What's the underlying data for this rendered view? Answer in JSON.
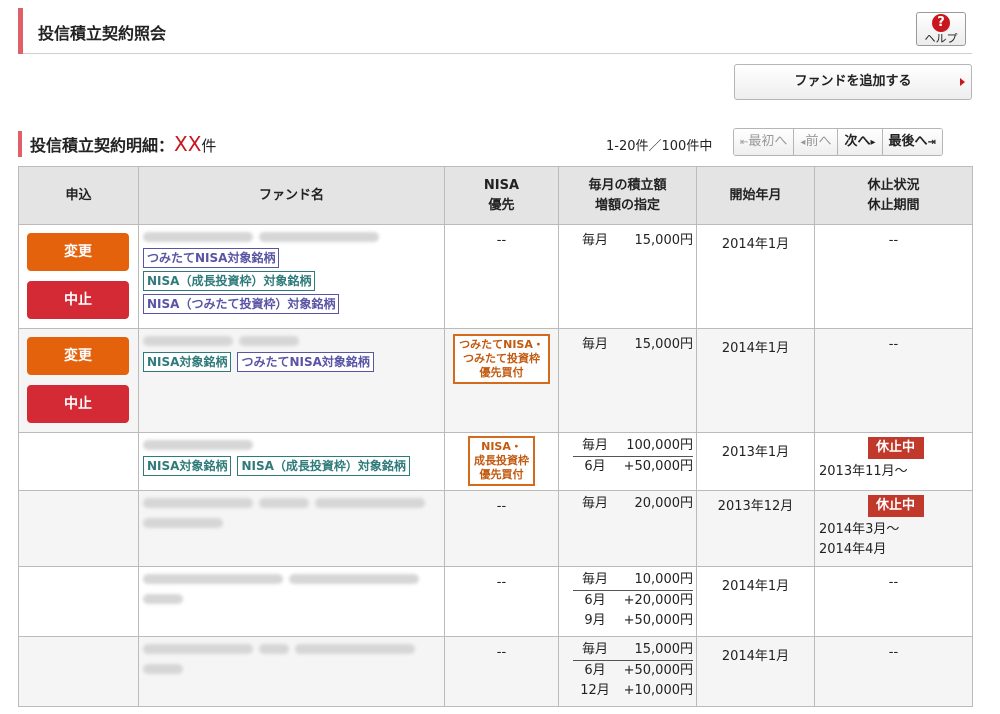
{
  "header": {
    "title": "投信積立契約照会",
    "help_label": "ヘルプ"
  },
  "add_fund_label": "ファンドを追加する",
  "section": {
    "title": "投信積立契約明細：",
    "count": "XX",
    "unit": "件"
  },
  "range_text": "1-20件／100件中",
  "pager": {
    "first": "最初へ",
    "prev": "前へ",
    "next": "次へ",
    "last": "最後へ"
  },
  "columns": [
    "申込",
    "ファンド名",
    "NISA",
    "優先",
    "毎月の積立額",
    "増額の指定",
    "開始年月",
    "休止状況",
    "休止期間"
  ],
  "labels": {
    "change": "変更",
    "stop": "中止",
    "dash": "--",
    "suspended": "休止中",
    "monthly": "毎月"
  },
  "tags": {
    "tsumitate": "つみたてNISA対象銘柄",
    "growth": "NISA（成長投資枠）対象銘柄",
    "tsumitate_waku": "NISA（つみたて投資枠）対象銘柄",
    "nisa": "NISA対象銘柄"
  },
  "rows": [
    {
      "amount": "15,000円",
      "start": "2014年1月"
    },
    {
      "nisa_l1": "つみたてNISA・",
      "nisa_l2": "つみたて投資枠",
      "nisa_l3": "優先買付",
      "amount": "15,000円",
      "start": "2014年1月"
    },
    {
      "nisa_l1": "NISA・",
      "nisa_l2": "成長投資枠",
      "nisa_l3": "優先買付",
      "amount": "100,000円",
      "inc1_m": "6月",
      "inc1_a": "+50,000円",
      "start": "2013年1月",
      "period1": "2013年11月～"
    },
    {
      "amount": "20,000円",
      "start": "2013年12月",
      "period1": "2014年3月～",
      "period2": "2014年4月"
    },
    {
      "amount": "10,000円",
      "inc1_m": "6月",
      "inc1_a": "+20,000円",
      "inc2_m": "9月",
      "inc2_a": "+50,000円",
      "start": "2014年1月"
    },
    {
      "amount": "15,000円",
      "inc1_m": "6月",
      "inc1_a": "+50,000円",
      "inc2_m": "12月",
      "inc2_a": "+10,000円",
      "start": "2014年1月"
    }
  ]
}
